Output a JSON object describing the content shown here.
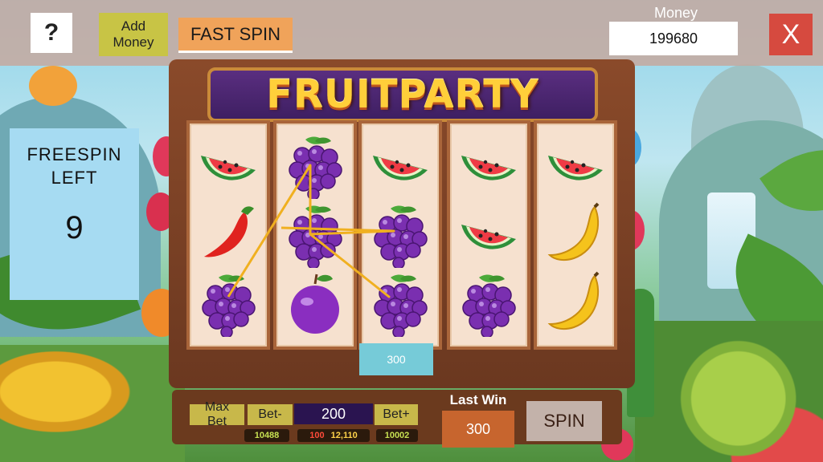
{
  "topbar": {
    "help_label": "?",
    "add_money_line1": "Add",
    "add_money_line2": "Money",
    "fast_spin_label": "FAST SPIN",
    "money_label": "Money",
    "money_value": "199680",
    "close_label": "X"
  },
  "freespin": {
    "label_line1": "FREESPIN",
    "label_line2": "LEFT",
    "count": "9"
  },
  "machine": {
    "title": "FRUITPARTY",
    "reels": [
      [
        "watermelon",
        "chili",
        "grapes"
      ],
      [
        "grapes",
        "grapes",
        "plum"
      ],
      [
        "watermelon",
        "grapes",
        "grapes"
      ],
      [
        "watermelon",
        "watermelon",
        "grapes"
      ],
      [
        "watermelon",
        "banana",
        "banana"
      ]
    ],
    "win_amount": "300",
    "payline_color": "#f0b020"
  },
  "controls": {
    "max_bet_label": "Max Bet",
    "bet_minus_label": "Bet-",
    "bet_value": "200",
    "bet_plus_label": "Bet+",
    "display1": "10488",
    "display2_red": "100",
    "display2_gold": "12,110",
    "display3": "10002",
    "last_win_label": "Last Win",
    "last_win_value": "300",
    "spin_label": "SPIN"
  }
}
